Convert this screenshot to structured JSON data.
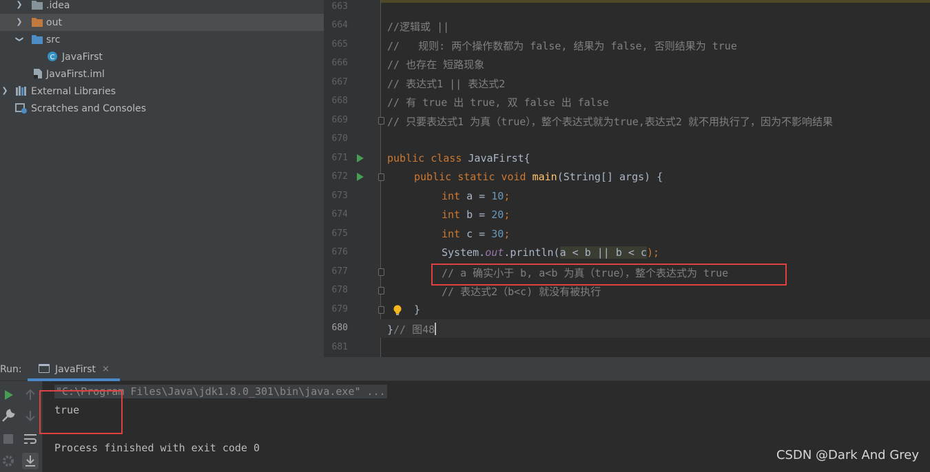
{
  "project_tree": {
    "items": [
      {
        "label": ".idea",
        "icon": "folder-icon",
        "expanded": false
      },
      {
        "label": "out",
        "icon": "folder-orange-icon",
        "expanded": false
      },
      {
        "label": "src",
        "icon": "folder-blue-icon",
        "expanded": true
      },
      {
        "label": "JavaFirst",
        "icon": "java-class-icon"
      },
      {
        "label": "JavaFirst.iml",
        "icon": "iml-file-icon"
      },
      {
        "label": "External Libraries",
        "icon": "library-icon",
        "expanded": false
      },
      {
        "label": "Scratches and Consoles",
        "icon": "scratches-icon"
      }
    ]
  },
  "editor": {
    "lines": [
      {
        "num": "663"
      },
      {
        "num": "664",
        "text": "//逻辑或 ||"
      },
      {
        "num": "665",
        "text": "//   规则: 两个操作数都为 false, 结果为 false, 否则结果为 true"
      },
      {
        "num": "666",
        "text": "// 也存在 短路现象"
      },
      {
        "num": "667",
        "text": "// 表达式1 || 表达式2"
      },
      {
        "num": "668",
        "text": "// 有 true 出 true, 双 false 出 false"
      },
      {
        "num": "669",
        "text": "// 只要表达式1 为真（true），整个表达式就为true,表达式2 就不用执行了，因为不影响结果"
      },
      {
        "num": "670"
      },
      {
        "num": "671",
        "kw1": "public class",
        "name": " JavaFirst{"
      },
      {
        "num": "672",
        "kw1": "public static void",
        "fn": "main",
        "rest": "(String[] args) {"
      },
      {
        "num": "673",
        "kw": "int",
        "rest": " a = ",
        "val": "10",
        "end": ";"
      },
      {
        "num": "674",
        "kw": "int",
        "rest": " b = ",
        "val": "20",
        "end": ";"
      },
      {
        "num": "675",
        "kw": "int",
        "rest": " c = ",
        "val": "30",
        "end": ";"
      },
      {
        "num": "676",
        "obj": "System.",
        "field": "out",
        "call": ".println(",
        "expr": "a < b || b < c",
        "end": ");"
      },
      {
        "num": "677",
        "text": "// a 确实小于 b, a<b 为真（true），整个表达式为 true"
      },
      {
        "num": "678",
        "text": "// 表达式2（b<c) 就没有被执行"
      },
      {
        "num": "679",
        "text": "}"
      },
      {
        "num": "680",
        "brace": "}",
        "text": "// 图48"
      },
      {
        "num": "681"
      }
    ]
  },
  "run_panel": {
    "title": "Run:",
    "tab_label": "JavaFirst",
    "tab_close": "×",
    "command": "\"C:\\Program Files\\Java\\jdk1.8.0_301\\bin\\java.exe\" ...",
    "output": "true",
    "exit_message": "Process finished with exit code 0"
  },
  "watermark": "CSDN @Dark And Grey",
  "colors": {
    "keyword": "#cc7832",
    "number": "#6897bb",
    "comment": "#808080",
    "highlight_box": "#e0403e",
    "run_arrow": "#499c54"
  }
}
